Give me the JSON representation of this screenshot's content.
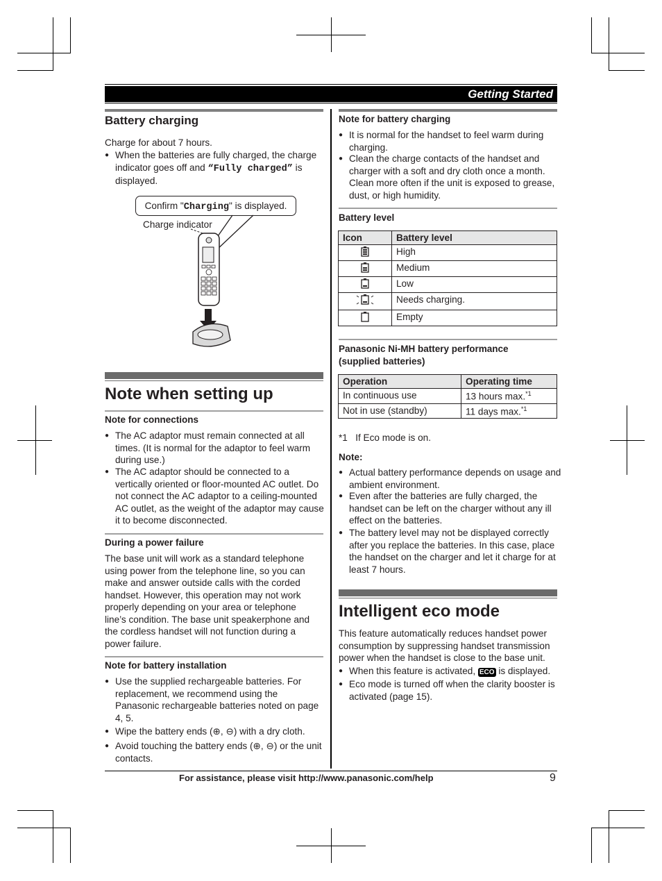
{
  "header": {
    "section_title": "Getting Started"
  },
  "left": {
    "battery_charging": {
      "title": "Battery charging",
      "intro": "Charge for about 7 hours.",
      "bullet_pre": "When the batteries are fully charged, the charge indicator goes off and ",
      "bullet_mono": "“Fully charged”",
      "bullet_post": " is displayed.",
      "callout_pre": "Confirm \"",
      "callout_mono": "Charging",
      "callout_post": "\" is displayed.",
      "charge_indicator_label": "Charge indicator"
    },
    "note_setting_up": {
      "title": "Note when setting up",
      "connections": {
        "title": "Note for connections",
        "bullets": [
          "The AC adaptor must remain connected at all times. (It is normal for the adaptor to feel warm during use.)",
          "The AC adaptor should be connected to a vertically oriented or floor-mounted AC outlet. Do not connect the AC adaptor to a ceiling-mounted AC outlet, as the weight of the adaptor may cause it to become disconnected."
        ]
      },
      "power_failure": {
        "title": "During a power failure",
        "text": "The base unit will work as a standard telephone using power from the telephone line, so you can make and answer outside calls with the corded handset. However, this operation may not work properly depending on your area or telephone line’s condition. The base unit speakerphone and the cordless handset will not function during a power failure."
      },
      "battery_installation": {
        "title": "Note for battery installation",
        "bullets": [
          "Use the supplied rechargeable batteries. For replacement, we recommend using the Panasonic rechargeable batteries noted on page 4, 5.",
          "Wipe the battery ends (⊕, ⊖) with a dry cloth.",
          "Avoid touching the battery ends (⊕, ⊖) or the unit contacts."
        ]
      }
    }
  },
  "right": {
    "battery_charging_note": {
      "title": "Note for battery charging",
      "bullets": [
        "It is normal for the handset to feel warm during charging.",
        "Clean the charge contacts of the handset and charger with a soft and dry cloth once a month. Clean more often if the unit is exposed to grease, dust, or high humidity."
      ]
    },
    "battery_level": {
      "title": "Battery level",
      "headers": [
        "Icon",
        "Battery level"
      ],
      "rows": [
        {
          "icon": "battery-high-icon",
          "label": "High"
        },
        {
          "icon": "battery-medium-icon",
          "label": "Medium"
        },
        {
          "icon": "battery-low-icon",
          "label": "Low"
        },
        {
          "icon": "battery-flashing-icon",
          "label": "Needs charging."
        },
        {
          "icon": "battery-empty-icon",
          "label": "Empty"
        }
      ]
    },
    "performance": {
      "title": "Panasonic Ni-MH battery performance (supplied batteries)",
      "headers": [
        "Operation",
        "Operating time"
      ],
      "rows": [
        {
          "operation": "In continuous use",
          "time": "13 hours max.",
          "note": "*1"
        },
        {
          "operation": "Not in use (standby)",
          "time": "11 days max.",
          "note": "*1"
        }
      ],
      "footnote_mark": "*1",
      "footnote_text": "If Eco mode is on."
    },
    "note": {
      "title": "Note:",
      "bullets": [
        "Actual battery performance depends on usage and ambient environment.",
        "Even after the batteries are fully charged, the handset can be left on the charger without any ill effect on the batteries.",
        "The battery level may not be displayed correctly after you replace the batteries. In this case, place the handset on the charger and let it charge for at least 7 hours."
      ]
    },
    "eco_mode": {
      "title": "Intelligent eco mode",
      "text": "This feature automatically reduces handset power consumption by suppressing handset transmission power when the handset is close to the base unit.",
      "bullet1_pre": "When this feature is activated, ",
      "eco_badge": "ECO",
      "bullet1_post": " is displayed.",
      "bullet2": "Eco mode is turned off when the clarity booster is activated (page 15)."
    }
  },
  "footer": {
    "assistance": "For assistance, please visit http://www.panasonic.com/help",
    "page_number": "9"
  }
}
